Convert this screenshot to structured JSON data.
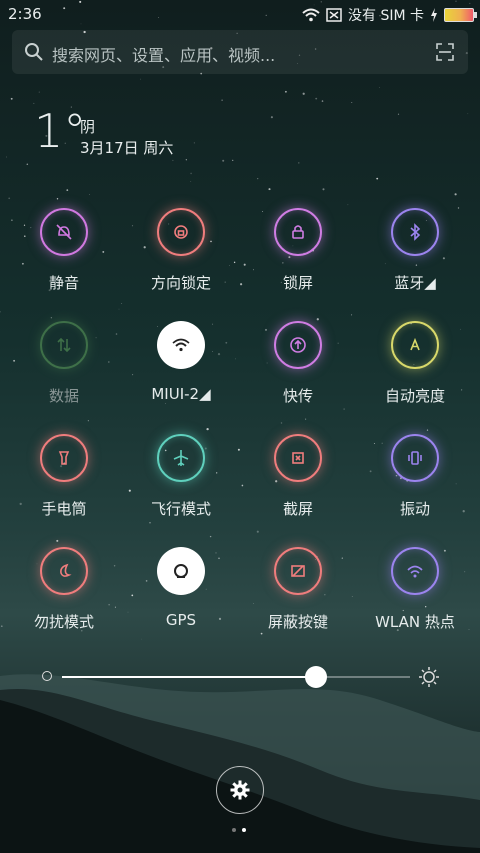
{
  "status_bar": {
    "time": "2:36",
    "carrier_text": "没有 SIM 卡",
    "icons": [
      "wifi-icon",
      "sim-x-icon",
      "charging-icon",
      "battery-icon"
    ]
  },
  "search": {
    "placeholder": "搜索网页、设置、应用、视频...",
    "icons": [
      "search-icon",
      "scan-icon"
    ]
  },
  "weather": {
    "temperature": "1°",
    "condition": "阴",
    "date": "3月17日 周六"
  },
  "toggles": [
    {
      "label": "静音",
      "icon": "bell-off-icon",
      "color": "#d079e0",
      "active": false
    },
    {
      "label": "方向锁定",
      "icon": "rotation-lock-icon",
      "color": "#ef7d7d",
      "active": false
    },
    {
      "label": "锁屏",
      "icon": "lock-icon",
      "color": "#cf7de3",
      "active": false
    },
    {
      "label": "蓝牙◢",
      "icon": "bluetooth-icon",
      "color": "#9b84ee",
      "active": false
    },
    {
      "label": "数据",
      "icon": "data-icon",
      "color": "#5a9a5a",
      "active": false,
      "disabled": true
    },
    {
      "label": "MIUI-2◢",
      "icon": "wifi-icon",
      "color": "#ffffff",
      "active": true
    },
    {
      "label": "快传",
      "icon": "share-icon",
      "color": "#cf7de3",
      "active": false
    },
    {
      "label": "自动亮度",
      "icon": "auto-brightness-icon",
      "color": "#d8d86a",
      "active": false
    },
    {
      "label": "手电筒",
      "icon": "flashlight-icon",
      "color": "#ef7d7d",
      "active": false
    },
    {
      "label": "飞行模式",
      "icon": "airplane-icon",
      "color": "#5fd0bd",
      "active": false
    },
    {
      "label": "截屏",
      "icon": "screenshot-icon",
      "color": "#ef7d7d",
      "active": false
    },
    {
      "label": "振动",
      "icon": "vibrate-icon",
      "color": "#9b84ee",
      "active": false
    },
    {
      "label": "勿扰模式",
      "icon": "moon-icon",
      "color": "#ef7d7d",
      "active": false
    },
    {
      "label": "GPS",
      "icon": "gps-icon",
      "color": "#ffffff",
      "active": true
    },
    {
      "label": "屏蔽按键",
      "icon": "block-keys-icon",
      "color": "#ef7d7d",
      "active": false
    },
    {
      "label": "WLAN 热点",
      "icon": "hotspot-icon",
      "color": "#9b84ee",
      "active": false
    }
  ],
  "brightness": {
    "level": 0.73
  },
  "pager": {
    "count": 2,
    "current": 1
  }
}
